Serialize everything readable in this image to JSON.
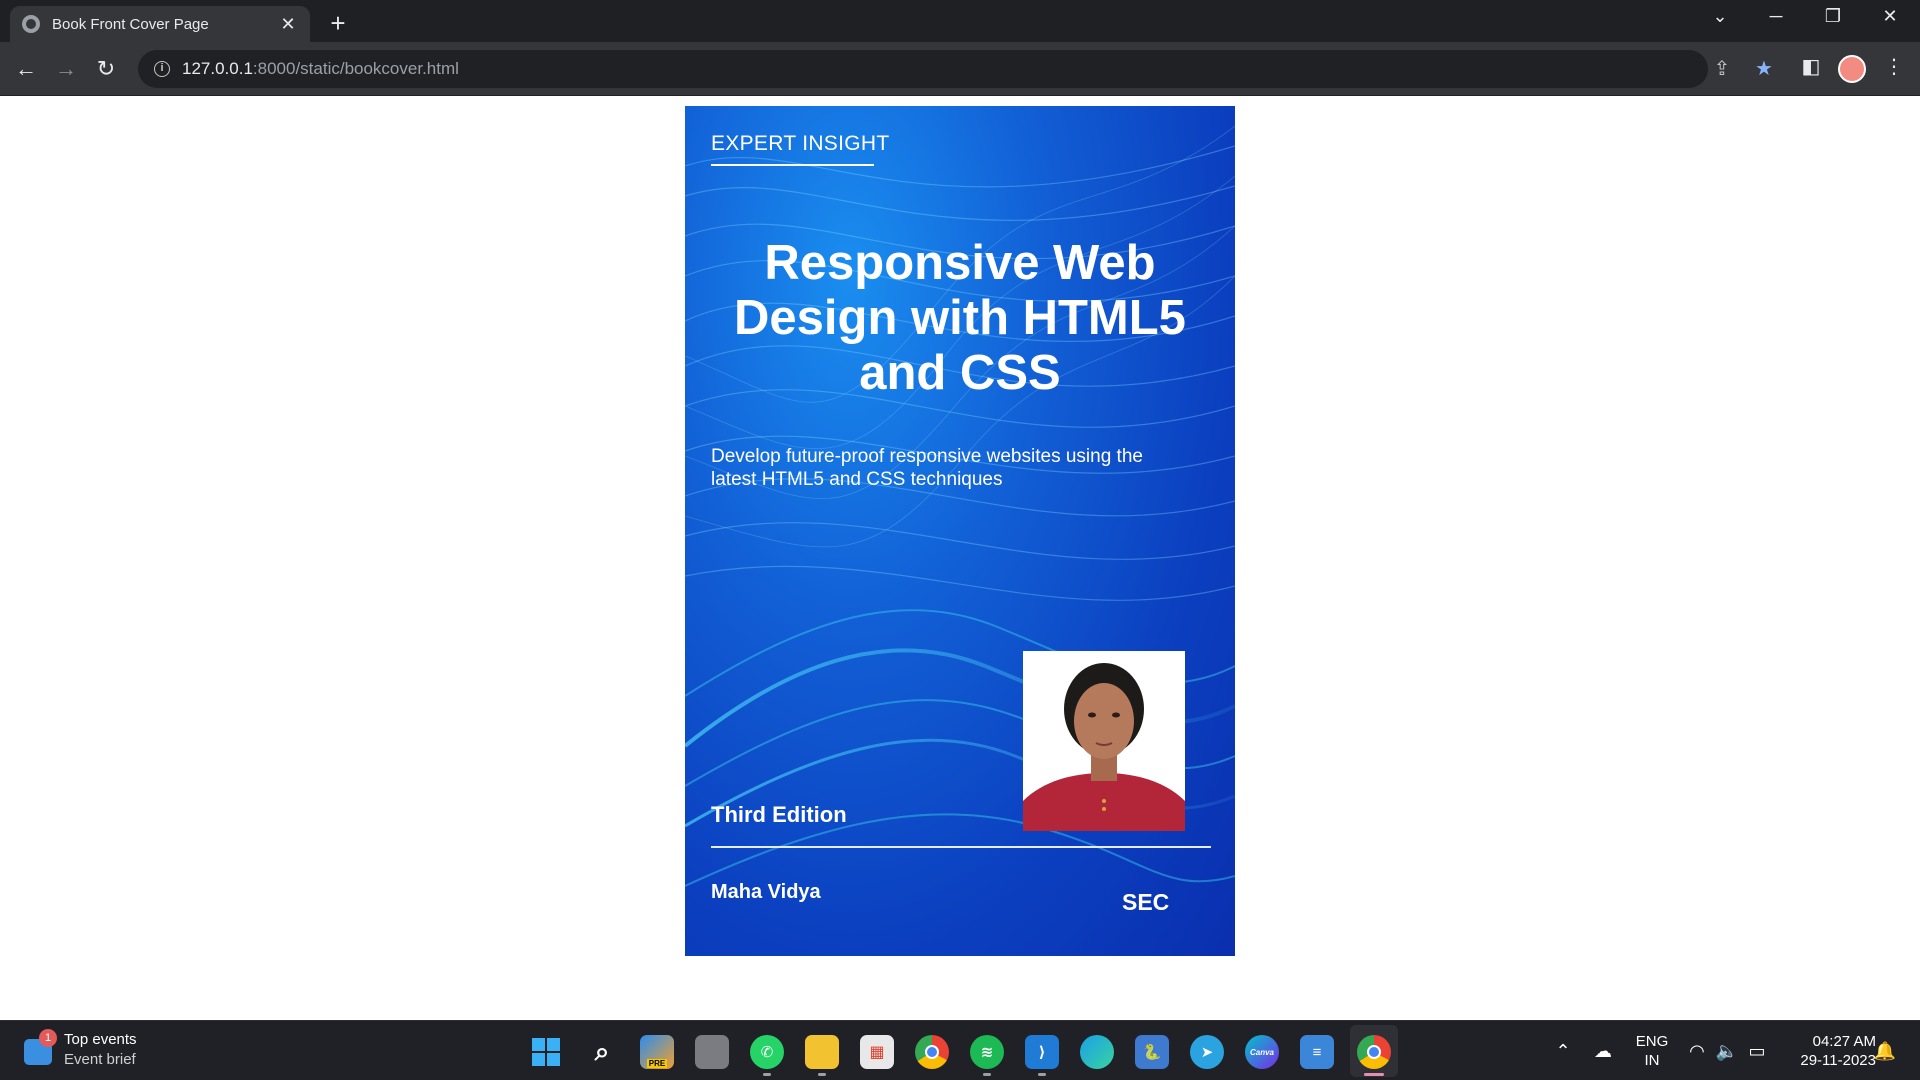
{
  "browser": {
    "tab_title": "Book Front Cover Page",
    "tab_close": "✕",
    "new_tab": "+",
    "url_host": "127.0.0.1",
    "url_rest": ":8000/static/bookcover.html",
    "icons": [
      "back-arrow-icon",
      "forward-arrow-icon",
      "reload-icon",
      "info-icon",
      "share-icon",
      "bookmark-star-icon",
      "side-panel-icon",
      "profile-avatar",
      "more-menu-icon"
    ]
  },
  "cover": {
    "tag": "EXPERT INSIGHT",
    "title": "Responsive Web Design with HTML5 and CSS",
    "subtitle": "Develop future-proof responsive websites using the latest HTML5 and CSS techniques",
    "edition": "Third Edition",
    "author": "Maha Vidya",
    "publisher": "SEC",
    "colors": {
      "background": "#1260d6",
      "accent_wave": "#3fd0f0",
      "text": "#ffffff"
    }
  },
  "taskbar": {
    "widget_badge": "1",
    "widget_title": "Top events",
    "widget_subtitle": "Event brief",
    "language_line1": "ENG",
    "language_line2": "IN",
    "time": "04:27 AM",
    "date": "29-11-2023",
    "canva_label": "Canva",
    "pre_badge": "PRE"
  }
}
